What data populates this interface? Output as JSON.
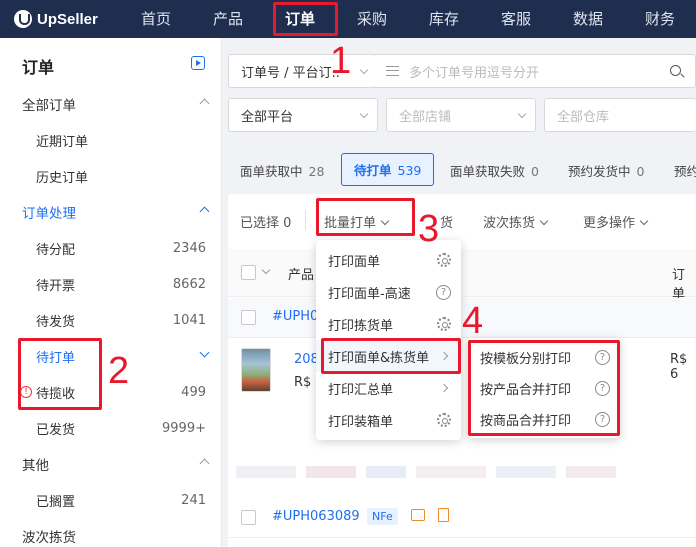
{
  "brand": {
    "name": "UpSeller"
  },
  "topnav": [
    "首页",
    "产品",
    "订单",
    "采购",
    "库存",
    "客服",
    "数据",
    "财务"
  ],
  "sidebar": {
    "title": "订单",
    "rows": [
      {
        "label": "全部订单",
        "count": ""
      },
      {
        "label": "近期订单",
        "count": ""
      },
      {
        "label": "历史订单",
        "count": ""
      },
      {
        "label": "订单处理",
        "count": ""
      },
      {
        "label": "待分配",
        "count": "2346"
      },
      {
        "label": "待开票",
        "count": "8662"
      },
      {
        "label": "待发货",
        "count": "1041"
      },
      {
        "label": "待打单",
        "count": ""
      },
      {
        "label": "待揽收",
        "count": "499"
      },
      {
        "label": "已发货",
        "count": "9999+"
      },
      {
        "label": "其他",
        "count": ""
      },
      {
        "label": "已搁置",
        "count": "241"
      },
      {
        "label": "波次拣货",
        "count": ""
      }
    ],
    "warn_mark": "!"
  },
  "filters": {
    "order_type": "订单号 / 平台订..",
    "search_placeholder": "多个订单号用逗号分开",
    "platform": "全部平台",
    "store_placeholder": "全部店铺",
    "warehouse_placeholder": "全部仓库"
  },
  "tabs": [
    {
      "label": "面单获取中",
      "count": "28"
    },
    {
      "label": "待打单",
      "count": "539"
    },
    {
      "label": "面单获取失败",
      "count": "0"
    },
    {
      "label": "预约发货中",
      "count": "0"
    },
    {
      "label": "预约",
      "count": ""
    }
  ],
  "toolbar": {
    "selected": "已选择 0",
    "batch_print": "批量打单",
    "ship_partial": "货",
    "wave_pick": "波次拣货",
    "more": "更多操作"
  },
  "table": {
    "col_product": "产品",
    "col_order": "订单"
  },
  "orders": [
    {
      "number": "#UPH0"
    },
    {
      "product_id": "208",
      "price_short": "R$",
      "price_right": "R$ 6"
    },
    {
      "number": "#UPH063089",
      "tag": "NFe"
    }
  ],
  "print_menu": [
    {
      "label": "打印面单",
      "icon": "gear-icon"
    },
    {
      "label": "打印面单-高速",
      "icon": "help-icon"
    },
    {
      "label": "打印拣货单",
      "icon": "gear-icon"
    },
    {
      "label": "打印面单&拣货单",
      "icon": "chevron-right-icon"
    },
    {
      "label": "打印汇总单",
      "icon": "chevron-right-icon"
    },
    {
      "label": "打印装箱单",
      "icon": "gear-icon"
    }
  ],
  "sub_menu": [
    {
      "label": "按模板分别打印"
    },
    {
      "label": "按产品合并打印"
    },
    {
      "label": "按商品合并打印"
    }
  ],
  "help_glyph": "?",
  "annotations": [
    "1",
    "2",
    "3",
    "4"
  ],
  "colors": {
    "nav_bg": "#1f2d4e",
    "accent": "#1e6ff1",
    "annotation": "#e8192c"
  }
}
